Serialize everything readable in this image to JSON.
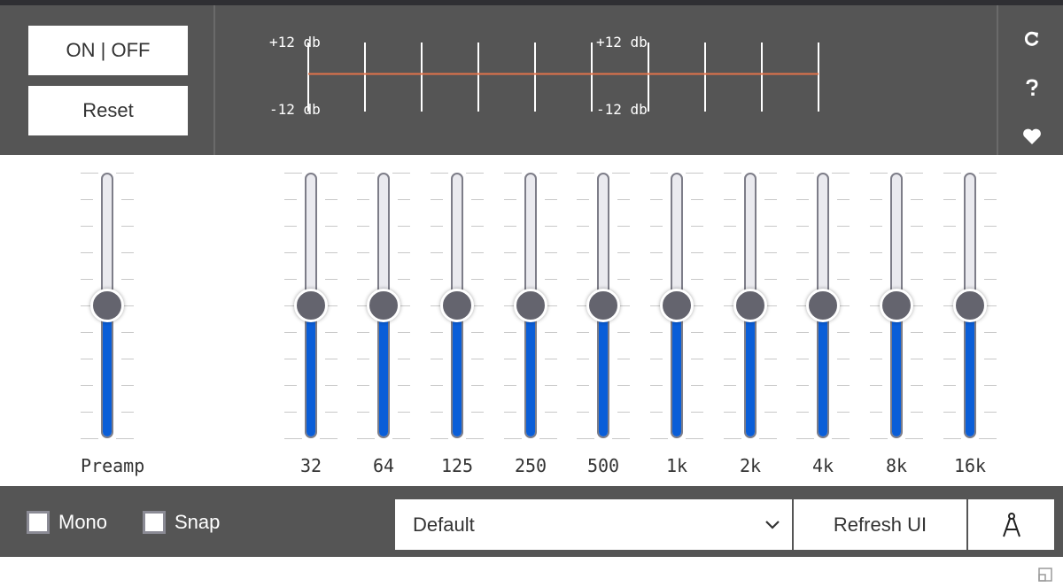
{
  "controls": {
    "onoff_label": "ON | OFF",
    "reset_label": "Reset"
  },
  "preview": {
    "db_top": "+12 db",
    "db_bottom": "-12 db",
    "curve_color": "#e2734a"
  },
  "side_icons": [
    "refresh-icon",
    "help-icon",
    "heart-icon"
  ],
  "sliders": [
    {
      "label": "Preamp",
      "value_db": 0
    },
    {
      "label": "32",
      "value_db": 0
    },
    {
      "label": "64",
      "value_db": 0
    },
    {
      "label": "125",
      "value_db": 0
    },
    {
      "label": "250",
      "value_db": 0
    },
    {
      "label": "500",
      "value_db": 0
    },
    {
      "label": "1k",
      "value_db": 0
    },
    {
      "label": "2k",
      "value_db": 0
    },
    {
      "label": "4k",
      "value_db": 0
    },
    {
      "label": "8k",
      "value_db": 0
    },
    {
      "label": "16k",
      "value_db": 0
    }
  ],
  "range_db": [
    -12,
    12
  ],
  "bottom": {
    "mono_label": "Mono",
    "mono_checked": false,
    "snap_label": "Snap",
    "snap_checked": false,
    "preset_value": "Default",
    "refresh_label": "Refresh UI",
    "compass_icon": "compass-icon"
  },
  "colors": {
    "accent": "#0a5ed8",
    "panel": "#555555",
    "thumb": "#64646e"
  }
}
